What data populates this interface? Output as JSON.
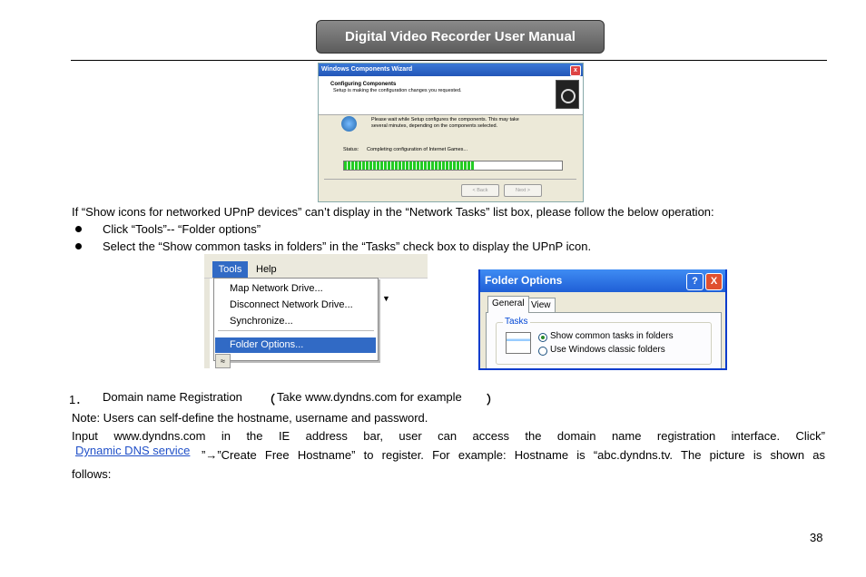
{
  "header": {
    "title": "Digital Video Recorder User Manual"
  },
  "wizard": {
    "title": "Windows Components Wizard",
    "heading": "Configuring Components",
    "subheading": "Setup is making the configuration changes you requested.",
    "message_line1": "Please wait while Setup configures the components. This may take",
    "message_line2": "several minutes, depending on the components selected.",
    "status_label": "Status:",
    "status_value": "Completing configuration of Internet Games...",
    "progress": 0.6,
    "back_label": "< Back",
    "next_label": "Next >",
    "close_glyph": "x"
  },
  "intro": "If “Show icons for networked UPnP devices” can’t display in the “Network Tasks” list box, please follow the below operation:",
  "bullets": [
    "Click “Tools”-- “Folder options”",
    "Select the “Show common tasks in folders” in the “Tasks” check box to display the UPnP icon."
  ],
  "tools_menu": {
    "menu_tools": "Tools",
    "menu_help": "Help",
    "items": [
      "Map Network Drive...",
      "Disconnect Network Drive...",
      "Synchronize...",
      "Folder Options..."
    ],
    "collapse_glyph": "≈"
  },
  "folder_options": {
    "title": "Folder Options",
    "help_glyph": "?",
    "close_glyph": "X",
    "tab_general": "General",
    "tab_view": "View",
    "group_label": "Tasks",
    "option1": "Show common tasks in folders",
    "option2": "Use Windows classic folders"
  },
  "section": {
    "number": "1．",
    "title": "Domain name Registration",
    "paren_open": "（",
    "paren_text": "Take www.dyndns.com for example",
    "paren_close": "）"
  },
  "note": "Note: Users can self-define the hostname, username and password.",
  "input_line": "Input www.dyndns.com in the IE address bar, user can access the domain name registration interface. Click”",
  "link_text": "Dynamic DNS service",
  "after_link": "”→”Create Free Hostname” to register. For example: Hostname is “abc.dyndns.tv. The picture is shown as",
  "follows": "follows:",
  "page_number": "38"
}
